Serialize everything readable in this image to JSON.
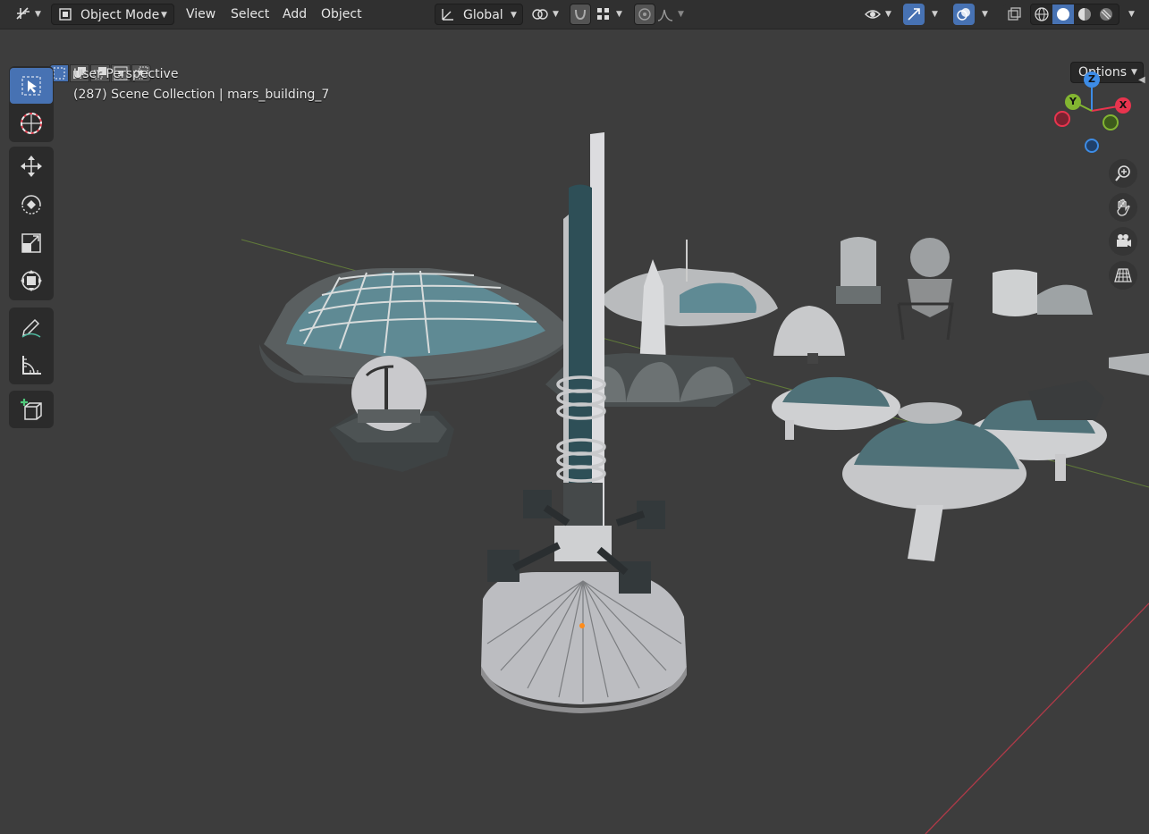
{
  "header": {
    "mode": "Object Mode",
    "menus": [
      "View",
      "Select",
      "Add",
      "Object"
    ],
    "orientation": "Global"
  },
  "subheader": {
    "options_label": "Options"
  },
  "viewport": {
    "view_name": "User Perspective",
    "collection_info": "(287) Scene Collection | mars_building_7"
  },
  "gizmo": {
    "z": "Z",
    "y": "Y",
    "x": "X"
  },
  "icons": {
    "editor_type": "editor-type-icon",
    "mode": "object-mode-icon",
    "transform_orientation": "orientation-icon",
    "pivot": "pivot-icon",
    "snap": "snap-icon",
    "proportional": "proportional-edit-icon",
    "visibility": "eye-icon",
    "gizmo": "gizmo-icon",
    "overlay": "overlay-icon",
    "xray": "xray-icon",
    "shading": [
      "wireframe-icon",
      "solid-icon",
      "material-icon",
      "rendered-icon"
    ]
  },
  "colors": {
    "accent": "#4772b3",
    "axis_x": "#e8344e",
    "axis_y": "#82b531",
    "axis_z": "#3d8ce6"
  }
}
